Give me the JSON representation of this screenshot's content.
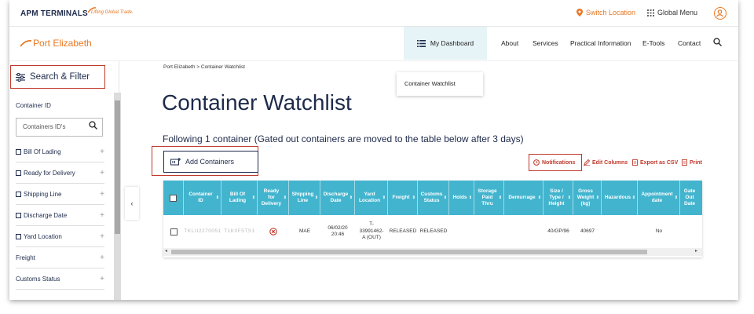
{
  "topbar": {
    "brand": "APM TERMINALS",
    "tagline": "Lifting Global Trade.",
    "switch_location": "Switch Location",
    "global_menu": "Global Menu"
  },
  "nav": {
    "site_name": "Port Elizabeth",
    "dashboard": "My Dashboard",
    "links": [
      "About",
      "Services",
      "Practical Information",
      "E-Tools",
      "Contact"
    ],
    "dropdown_item": "Container Watchlist"
  },
  "sidebar": {
    "search_filter": "Search & Filter",
    "container_id_label": "Container ID",
    "container_id_placeholder": "Containers ID's",
    "filters": [
      {
        "label": "Bill Of Lading",
        "checkbox": true
      },
      {
        "label": "Ready for Delivery",
        "checkbox": true
      },
      {
        "label": "Shipping Line",
        "checkbox": true
      },
      {
        "label": "Discharge Date",
        "checkbox": true
      },
      {
        "label": "Yard Location",
        "checkbox": true
      },
      {
        "label": "Freight",
        "checkbox": false
      },
      {
        "label": "Customs Status",
        "checkbox": false
      }
    ]
  },
  "main": {
    "breadcrumb": "Port Elizabeth  > Container Watchlist",
    "title": "Container Watchlist",
    "subtitle": "Following 1 container (Gated out containers are moved to the table below after 3 days)",
    "add_containers": "Add Containers",
    "actions": {
      "notifications": "Notifications",
      "edit_columns": "Edit Columns",
      "export_csv": "Export as CSV",
      "print": "Print"
    }
  },
  "table": {
    "headers": [
      {
        "line1": "Container",
        "line2": "ID"
      },
      {
        "line1": "Bill Of",
        "line2": "Lading"
      },
      {
        "line1": "Ready",
        "line2": "for",
        "line3": "Delivery"
      },
      {
        "line1": "Shipping",
        "line2": "Line"
      },
      {
        "line1": "Discharge",
        "line2": "Date"
      },
      {
        "line1": "Yard",
        "line2": "Location"
      },
      {
        "line1": "Freight"
      },
      {
        "line1": "Customs",
        "line2": "Status"
      },
      {
        "line1": "Holds"
      },
      {
        "line1": "Storage",
        "line2": "Paid",
        "line3": "Thru"
      },
      {
        "line1": "Demurrage"
      },
      {
        "line1": "Size /",
        "line2": "Type /",
        "line3": "Height"
      },
      {
        "line1": "Gross",
        "line2": "Weight",
        "line3": "(kg)"
      },
      {
        "line1": "Hazardous"
      },
      {
        "line1": "Appointment",
        "line2": "date"
      },
      {
        "line1": "Gate",
        "line2": "Out",
        "line3": "Date"
      }
    ],
    "row": {
      "container_id": "TKLU2270051",
      "bill_of_lading": "T1K0F5TS1",
      "shipping_line": "MAE",
      "discharge_date_1": "06/02/20",
      "discharge_date_2": "20:46",
      "yard_1": "T-",
      "yard_2": "33991462-",
      "yard_3": "A (OUT)",
      "freight": "RELEASED",
      "customs": "RELEASED",
      "size": "40/GP/96",
      "weight": "40697",
      "appointment": "No"
    }
  }
}
